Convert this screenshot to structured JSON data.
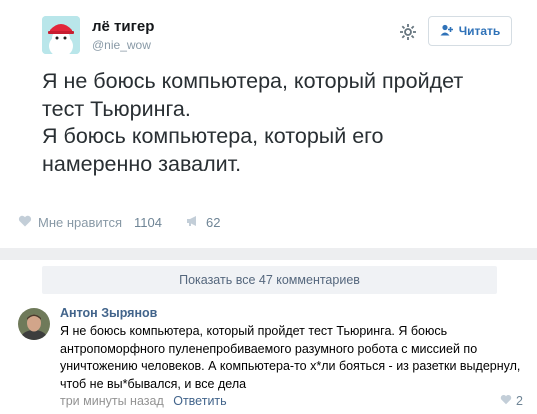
{
  "tweet": {
    "author_name": "лё тигер",
    "author_handle": "@nie_wow",
    "follow_label": "Читать",
    "text": "Я не боюсь компьютера, который пройдет\nтест Тьюринга.\nЯ боюсь компьютера, который его\nнамеренно завалит."
  },
  "actions": {
    "like_label": "Мне нравится",
    "like_count": "1104",
    "share_count": "62"
  },
  "comments": {
    "show_all_label": "Показать все 47 комментариев",
    "items": [
      {
        "author": "Антон Зырянов",
        "text": "Я не боюсь компьютера, который пройдет тест Тьюринга. Я боюсь антропоморфного пуленепробиваемого разумного робота с миссией по уничтожению человеков. А компьютера-то х*ли бояться - из разетки выдернул, чтоб не вы*бывался, и все дела",
        "time": "три минуты назад",
        "reply_label": "Ответить",
        "likes": "2"
      }
    ]
  },
  "colors": {
    "accent": "#2f72b8",
    "link": "#42648b",
    "muted": "#8899a6",
    "separator": "#edeef0"
  },
  "icons": [
    "gear-icon",
    "follow-person-icon",
    "heart-icon",
    "megaphone-icon",
    "like-icon"
  ]
}
